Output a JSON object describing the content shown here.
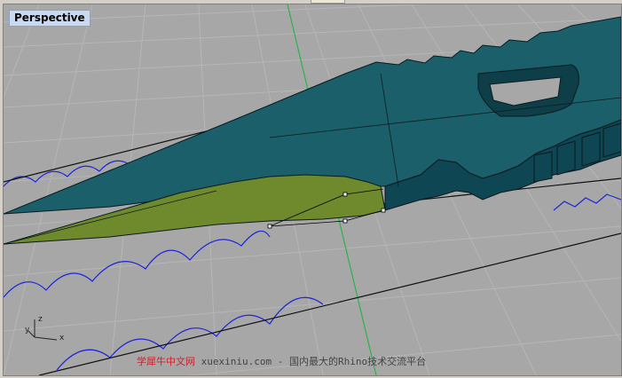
{
  "viewport": {
    "title": "Perspective"
  },
  "axes_widget": {
    "x": "x",
    "y": "y",
    "z": "z"
  },
  "watermark": {
    "brand": "学犀牛中文网",
    "url": "xuexiniu.com",
    "dash": "-",
    "slogan": "国内最大的Rhino技术交流平台"
  },
  "colors": {
    "grid_background": "#a7a7a7",
    "grid_line": "#b5b5b5",
    "grid_axis_green": "#2bb24a",
    "grid_axis_red": "#d63a3a",
    "solid_teal": "#1a5f6a",
    "solid_side": "#0f4654",
    "surface_green": "#6f8a2c",
    "curve_blue": "#1f25d8",
    "edge_black": "#101010",
    "title_bg": "#c9d9ef"
  }
}
